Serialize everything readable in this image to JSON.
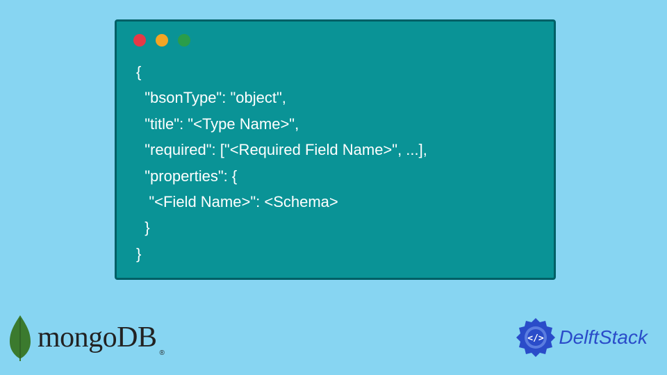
{
  "code": {
    "line1": "{",
    "line2": "  \"bsonType\": \"object\",",
    "line3": "  \"title\": \"<Type Name>\",",
    "line4": "  \"required\": [\"<Required Field Name>\", ...],",
    "line5": "  \"properties\": {",
    "line6": "   \"<Field Name>\": <Schema>",
    "line7": "  }",
    "line8": "}"
  },
  "logos": {
    "mongo": "mongoDB",
    "mongo_reg": "®",
    "delft": "DelftStack"
  }
}
